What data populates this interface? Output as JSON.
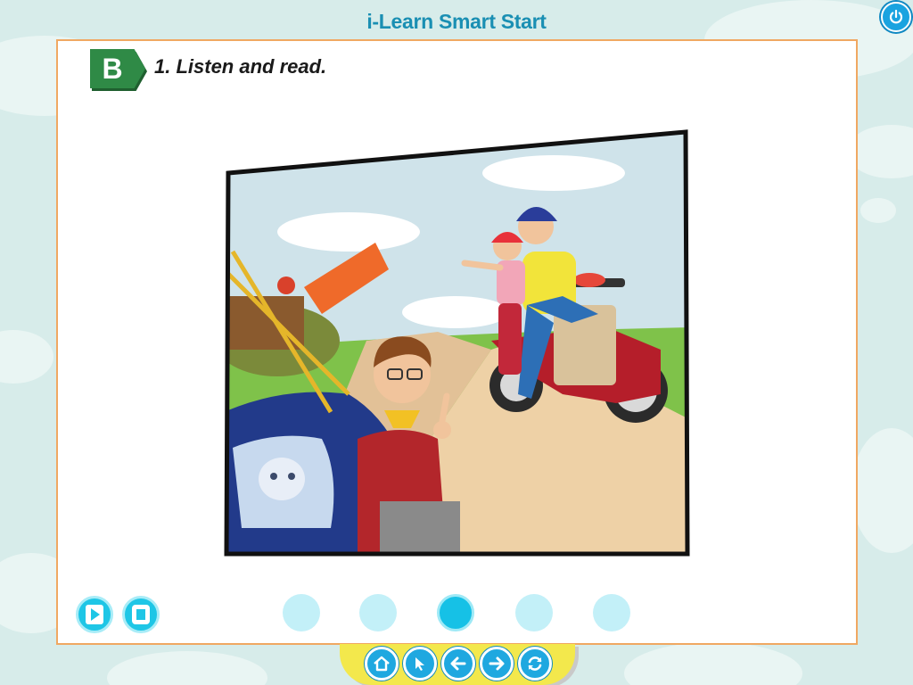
{
  "header": {
    "app_title": "i-Learn Smart Start"
  },
  "window_controls": {
    "power_icon": "power-icon"
  },
  "lesson": {
    "section_letter": "B",
    "instruction": "1. Listen and read.",
    "illustration_description_icon": "family-road-trip-illustration"
  },
  "audio_controls": {
    "play_icon": "play-icon",
    "stop_icon": "stop-icon"
  },
  "pager": {
    "total_pages": 5,
    "current_page": 3
  },
  "bottom_nav": {
    "buttons": [
      "home-icon",
      "select-arrow-icon",
      "back-arrow-icon",
      "forward-arrow-icon",
      "refresh-icon"
    ]
  },
  "colors": {
    "background": "#d7ecea",
    "accent_blue": "#1fa8e0",
    "cyan": "#1ec6e6",
    "badge_green": "#2f8a46",
    "panel_border": "#f0a862",
    "nav_yellow": "#f3e84c"
  }
}
